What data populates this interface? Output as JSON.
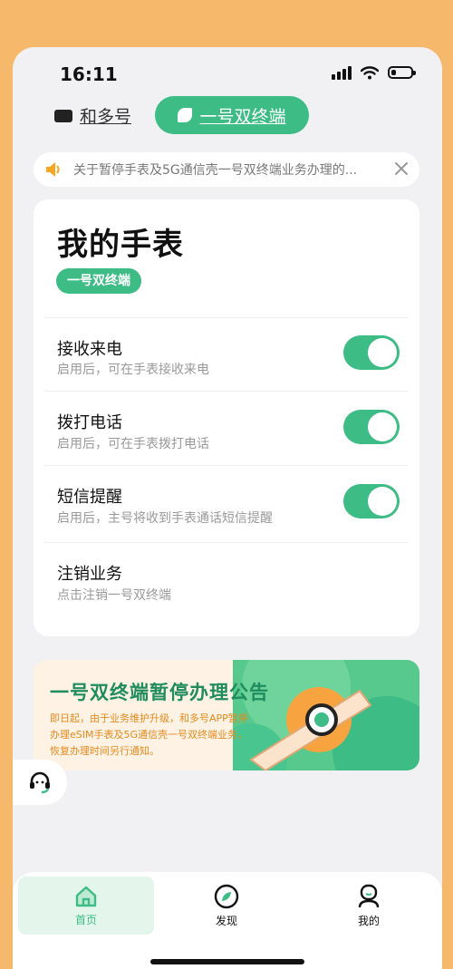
{
  "status": {
    "time": "16:11"
  },
  "nav": {
    "tab1": "和多号",
    "tab2": "一号双终端"
  },
  "notice": {
    "text": "关于暂停手表及5G通信壳一号双终端业务办理的..."
  },
  "card": {
    "title": "我的手表",
    "chip": "一号双终端",
    "rows": [
      {
        "title": "接收来电",
        "sub": "启用后，可在手表接收来电",
        "on": true
      },
      {
        "title": "拨打电话",
        "sub": "启用后，可在手表拨打电话",
        "on": true
      },
      {
        "title": "短信提醒",
        "sub": "启用后，主号将收到手表通话短信提醒",
        "on": true
      },
      {
        "title": "注销业务",
        "sub": "点击注销一号双终端"
      }
    ]
  },
  "banner": {
    "title": "一号双终端暂停办理公告",
    "body": "即日起，由于业务维护升级，和多号APP暂停办理eSIM手表及5G通信壳一号双终端业务，恢复办理时间另行通知。"
  },
  "bottom": {
    "home": "首页",
    "discover": "发现",
    "mine": "我的"
  },
  "colors": {
    "accent": "#3dbc85",
    "background": "#f6b86a"
  }
}
